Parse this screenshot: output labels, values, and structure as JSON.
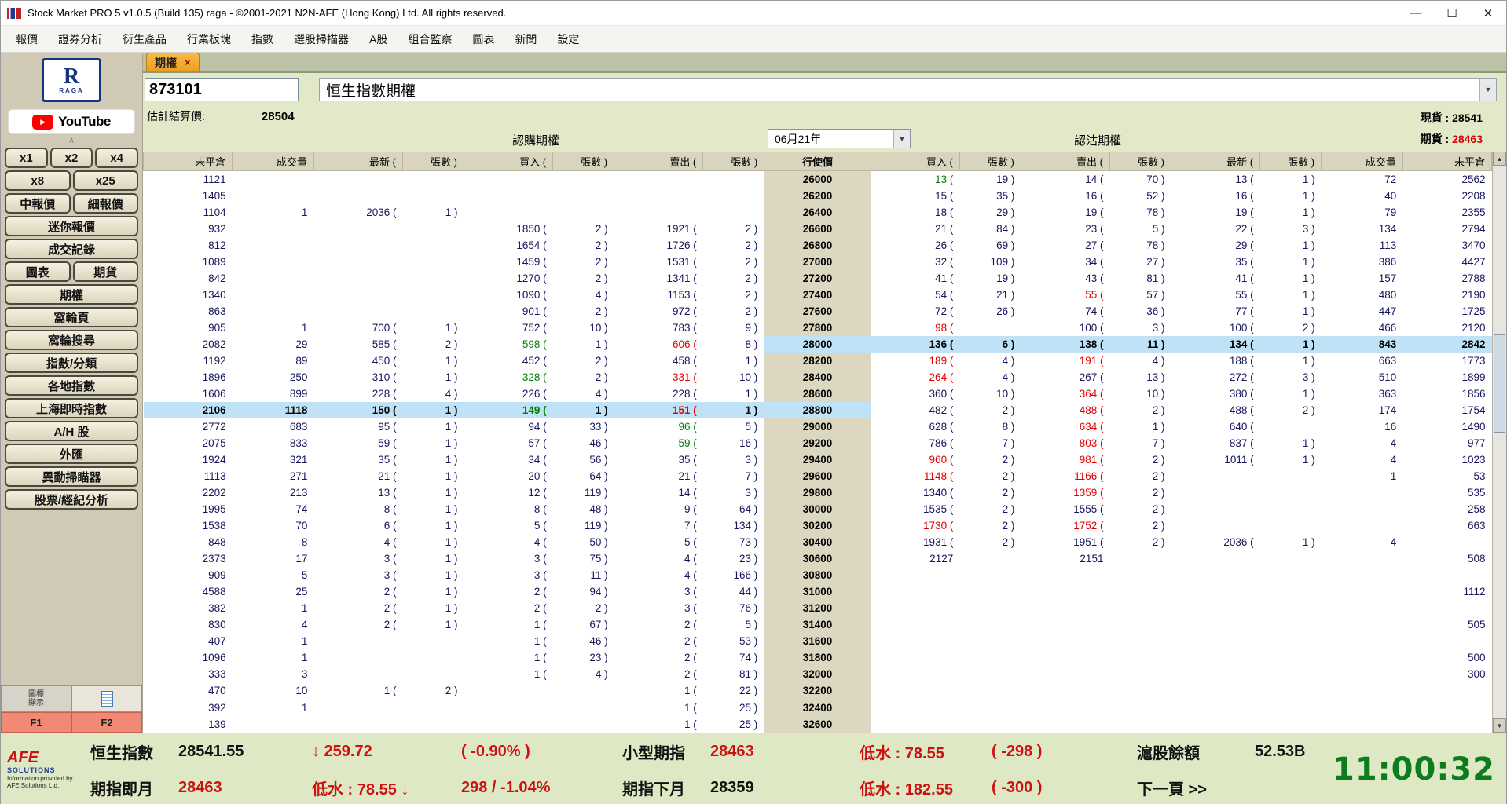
{
  "colors": {
    "accent_orange": "#ee9e1f",
    "up_green": "#007f00",
    "down_red": "#e00000",
    "highlight_blue": "#bfe2f6",
    "status_red": "#cc1111",
    "strike_beige": "#dcd7c1"
  },
  "window": {
    "title": "Stock Market PRO 5 v1.0.5 (Build 135) raga - ©2001-2021 N2N-AFE (Hong Kong) Ltd. All rights reserved.",
    "controls": {
      "minimize": "—",
      "maximize": "☐",
      "close": "✕"
    }
  },
  "menu": {
    "items": [
      "報價",
      "證券分析",
      "衍生產品",
      "行業板塊",
      "指數",
      "選股掃描器",
      "A股",
      "組合監察",
      "圖表",
      "新聞",
      "設定"
    ]
  },
  "sidebar": {
    "logo_r": "R",
    "logo_sub": "RAGA",
    "youtube": "YouTube",
    "play_icon": "▶",
    "collapse": "∧",
    "rows": [
      [
        "x1",
        "x2",
        "x4"
      ],
      [
        "x8",
        "x25"
      ],
      [
        "中報價",
        "細報價"
      ],
      [
        "迷你報價"
      ],
      [
        "成交記錄"
      ],
      [
        "圖表",
        "期貨"
      ],
      [
        "期權"
      ],
      [
        "窩輪頁"
      ],
      [
        "窩輪搜尋"
      ],
      [
        "指數/分類"
      ],
      [
        "各地指數"
      ],
      [
        "上海即時指數"
      ],
      [
        "A/H 股"
      ],
      [
        "外匯"
      ],
      [
        "異動掃瞄器"
      ],
      [
        "股票/經紀分析"
      ]
    ],
    "icon_display": "圖標顯示",
    "f1": "F1",
    "f2": "F2"
  },
  "quote": {
    "tab": "期權",
    "tab_close": "×",
    "symbol_input": "873101",
    "name": "恒生指數期權",
    "dropdown_icon": "▼",
    "est_settle_label": "估計結算價:",
    "est_settle": "28504",
    "spot_label": "現貨 :",
    "spot": "28541",
    "futures_label": "期貨 :",
    "futures": "28463",
    "call_header": "認購期權",
    "put_header": "認沽期權",
    "month": "06月21年"
  },
  "options_table": {
    "headers": [
      "未平倉",
      "成交量",
      "最新 (",
      "張數 )",
      "買入 (",
      "張數 )",
      "賣出 (",
      "張數 )",
      "行使價",
      "買入 (",
      "張數 )",
      "賣出 (",
      "張數 )",
      "最新 (",
      "張數 )",
      "成交量",
      "未平倉"
    ],
    "rows": [
      {
        "c": [
          "1121",
          "",
          "",
          "",
          "",
          "",
          "",
          "",
          "26000",
          "13 (",
          "19 )",
          "14 (",
          "70 )",
          "13 (",
          "1 )",
          "72",
          "2562"
        ],
        "k": {
          "9": "g"
        }
      },
      {
        "c": [
          "1405",
          "",
          "",
          "",
          "",
          "",
          "",
          "",
          "26200",
          "15 (",
          "35 )",
          "16 (",
          "52 )",
          "16 (",
          "1 )",
          "40",
          "2208"
        ]
      },
      {
        "c": [
          "1104",
          "1",
          "2036 (",
          "1 )",
          "",
          "",
          "",
          "",
          "26400",
          "18 (",
          "29 )",
          "19 (",
          "78 )",
          "19 (",
          "1 )",
          "79",
          "2355"
        ]
      },
      {
        "c": [
          "932",
          "",
          "",
          "",
          "1850 (",
          "2 )",
          "1921 (",
          "2 )",
          "26600",
          "21 (",
          "84 )",
          "23 (",
          "5 )",
          "22 (",
          "3 )",
          "134",
          "2794"
        ]
      },
      {
        "c": [
          "812",
          "",
          "",
          "",
          "1654 (",
          "2 )",
          "1726 (",
          "2 )",
          "26800",
          "26 (",
          "69 )",
          "27 (",
          "78 )",
          "29 (",
          "1 )",
          "113",
          "3470"
        ]
      },
      {
        "c": [
          "1089",
          "",
          "",
          "",
          "1459 (",
          "2 )",
          "1531 (",
          "2 )",
          "27000",
          "32 (",
          "109 )",
          "34 (",
          "27 )",
          "35 (",
          "1 )",
          "386",
          "4427"
        ]
      },
      {
        "c": [
          "842",
          "",
          "",
          "",
          "1270 (",
          "2 )",
          "1341 (",
          "2 )",
          "27200",
          "41 (",
          "19 )",
          "43 (",
          "81 )",
          "41 (",
          "1 )",
          "157",
          "2788"
        ]
      },
      {
        "c": [
          "1340",
          "",
          "",
          "",
          "1090 (",
          "4 )",
          "1153 (",
          "2 )",
          "27400",
          "54 (",
          "21 )",
          "55 (",
          "57 )",
          "55 (",
          "1 )",
          "480",
          "2190"
        ],
        "k": {
          "11": "r"
        }
      },
      {
        "c": [
          "863",
          "",
          "",
          "",
          "901 (",
          "2 )",
          "972 (",
          "2 )",
          "27600",
          "72 (",
          "26 )",
          "74 (",
          "36 )",
          "77 (",
          "1 )",
          "447",
          "1725"
        ]
      },
      {
        "c": [
          "905",
          "1",
          "700 (",
          "1 )",
          "752 (",
          "10 )",
          "783 (",
          "9 )",
          "27800",
          "98 (",
          "",
          "100 (",
          "3 )",
          "100 (",
          "2 )",
          "466",
          "2120"
        ],
        "k": {
          "9": "r"
        }
      },
      {
        "c": [
          "2082",
          "29",
          "585 (",
          "2 )",
          "598 (",
          "1 )",
          "606 (",
          "8 )",
          "28000",
          "136 (",
          "6 )",
          "138 (",
          "11 )",
          "134 (",
          "1 )",
          "843",
          "2842"
        ],
        "k": {
          "4": "g",
          "6": "r"
        },
        "h": "put"
      },
      {
        "c": [
          "1192",
          "89",
          "450 (",
          "1 )",
          "452 (",
          "2 )",
          "458 (",
          "1 )",
          "28200",
          "189 (",
          "4 )",
          "191 (",
          "4 )",
          "188 (",
          "1 )",
          "663",
          "1773"
        ],
        "k": {
          "9": "r",
          "11": "r"
        }
      },
      {
        "c": [
          "1896",
          "250",
          "310 (",
          "1 )",
          "328 (",
          "2 )",
          "331 (",
          "10 )",
          "28400",
          "264 (",
          "4 )",
          "267 (",
          "13 )",
          "272 (",
          "3 )",
          "510",
          "1899"
        ],
        "k": {
          "4": "g",
          "6": "r",
          "9": "r"
        }
      },
      {
        "c": [
          "1606",
          "899",
          "228 (",
          "4 )",
          "226 (",
          "4 )",
          "228 (",
          "1 )",
          "28600",
          "360 (",
          "10 )",
          "364 (",
          "10 )",
          "380 (",
          "1 )",
          "363",
          "1856"
        ],
        "k": {
          "11": "r"
        }
      },
      {
        "c": [
          "2106",
          "1118",
          "150 (",
          "1 )",
          "149 (",
          "1 )",
          "151 (",
          "1 )",
          "28800",
          "482 (",
          "2 )",
          "488 (",
          "2 )",
          "488 (",
          "2 )",
          "174",
          "1754"
        ],
        "k": {
          "4": "g",
          "6": "r",
          "11": "r"
        },
        "h": "call"
      },
      {
        "c": [
          "2772",
          "683",
          "95 (",
          "1 )",
          "94 (",
          "33 )",
          "96 (",
          "5 )",
          "29000",
          "628 (",
          "8 )",
          "634 (",
          "1 )",
          "640 (",
          "",
          "16",
          "1490"
        ],
        "k": {
          "6": "g",
          "11": "r"
        }
      },
      {
        "c": [
          "2075",
          "833",
          "59 (",
          "1 )",
          "57 (",
          "46 )",
          "59 (",
          "16 )",
          "29200",
          "786 (",
          "7 )",
          "803 (",
          "7 )",
          "837 (",
          "1 )",
          "4",
          "977"
        ],
        "k": {
          "6": "g",
          "11": "r"
        }
      },
      {
        "c": [
          "1924",
          "321",
          "35 (",
          "1 )",
          "34 (",
          "56 )",
          "35 (",
          "3 )",
          "29400",
          "960 (",
          "2 )",
          "981 (",
          "2 )",
          "1011 (",
          "1 )",
          "4",
          "1023"
        ],
        "k": {
          "9": "r",
          "11": "r"
        }
      },
      {
        "c": [
          "1113",
          "271",
          "21 (",
          "1 )",
          "20 (",
          "64 )",
          "21 (",
          "7 )",
          "29600",
          "1148 (",
          "2 )",
          "1166 (",
          "2 )",
          "",
          "",
          "1",
          "53"
        ],
        "k": {
          "9": "r",
          "11": "r"
        }
      },
      {
        "c": [
          "2202",
          "213",
          "13 (",
          "1 )",
          "12 (",
          "119 )",
          "14 (",
          "3 )",
          "29800",
          "1340 (",
          "2 )",
          "1359 (",
          "2 )",
          "",
          "",
          "",
          "535"
        ],
        "k": {
          "11": "r"
        }
      },
      {
        "c": [
          "1995",
          "74",
          "8 (",
          "1 )",
          "8 (",
          "48 )",
          "9 (",
          "64 )",
          "30000",
          "1535 (",
          "2 )",
          "1555 (",
          "2 )",
          "",
          "",
          "",
          "258"
        ]
      },
      {
        "c": [
          "1538",
          "70",
          "6 (",
          "1 )",
          "5 (",
          "119 )",
          "7 (",
          "134 )",
          "30200",
          "1730 (",
          "2 )",
          "1752 (",
          "2 )",
          "",
          "",
          "",
          "663"
        ],
        "k": {
          "9": "r",
          "11": "r"
        }
      },
      {
        "c": [
          "848",
          "8",
          "4 (",
          "1 )",
          "4 (",
          "50 )",
          "5 (",
          "73 )",
          "30400",
          "1931 (",
          "2 )",
          "1951 (",
          "2 )",
          "2036 (",
          "1 )",
          "4",
          ""
        ]
      },
      {
        "c": [
          "2373",
          "17",
          "3 (",
          "1 )",
          "3 (",
          "75 )",
          "4 (",
          "23 )",
          "30600",
          "2127",
          "",
          "2151",
          "",
          "",
          "",
          "",
          "508"
        ]
      },
      {
        "c": [
          "909",
          "5",
          "3 (",
          "1 )",
          "3 (",
          "11 )",
          "4 (",
          "166 )",
          "30800",
          "",
          "",
          "",
          "",
          "",
          "",
          "",
          ""
        ]
      },
      {
        "c": [
          "4588",
          "25",
          "2 (",
          "1 )",
          "2 (",
          "94 )",
          "3 (",
          "44 )",
          "31000",
          "",
          "",
          "",
          "",
          "",
          "",
          "",
          "1112"
        ]
      },
      {
        "c": [
          "382",
          "1",
          "2 (",
          "1 )",
          "2 (",
          "2 )",
          "3 (",
          "76 )",
          "31200",
          "",
          "",
          "",
          "",
          "",
          "",
          "",
          ""
        ]
      },
      {
        "c": [
          "830",
          "4",
          "2 (",
          "1 )",
          "1 (",
          "67 )",
          "2 (",
          "5 )",
          "31400",
          "",
          "",
          "",
          "",
          "",
          "",
          "",
          "505"
        ]
      },
      {
        "c": [
          "407",
          "1",
          "",
          "",
          "1 (",
          "46 )",
          "2 (",
          "53 )",
          "31600",
          "",
          "",
          "",
          "",
          "",
          "",
          "",
          ""
        ]
      },
      {
        "c": [
          "1096",
          "1",
          "",
          "",
          "1 (",
          "23 )",
          "2 (",
          "74 )",
          "31800",
          "",
          "",
          "",
          "",
          "",
          "",
          "",
          "500"
        ]
      },
      {
        "c": [
          "333",
          "3",
          "",
          "",
          "1 (",
          "4 )",
          "2 (",
          "81 )",
          "32000",
          "",
          "",
          "",
          "",
          "",
          "",
          "",
          "300"
        ]
      },
      {
        "c": [
          "470",
          "10",
          "1 (",
          "2 )",
          "",
          "",
          "1 (",
          "22 )",
          "32200",
          "",
          "",
          "",
          "",
          "",
          "",
          "",
          ""
        ]
      },
      {
        "c": [
          "392",
          "1",
          "",
          "",
          "",
          "",
          "1 (",
          "25 )",
          "32400",
          "",
          "",
          "",
          "",
          "",
          "",
          "",
          ""
        ]
      },
      {
        "c": [
          "139",
          "",
          "",
          "",
          "",
          "",
          "1 (",
          "25 )",
          "32600",
          "",
          "",
          "",
          "",
          "",
          "",
          "",
          ""
        ]
      }
    ]
  },
  "scrollbar": {
    "up_icon": "▲",
    "down_icon": "▼"
  },
  "status": {
    "rows": [
      [
        {
          "t": "恒生指數",
          "c": "k"
        },
        {
          "t": "28541.55",
          "c": "k"
        },
        {
          "t": "↓ 259.72",
          "c": "r"
        },
        {
          "t": "(   -0.90%   )",
          "c": "r"
        },
        {
          "t": "小型期指",
          "c": "k"
        },
        {
          "t": "28463",
          "c": "r"
        },
        {
          "t": "低水 : 78.55",
          "c": "r"
        },
        {
          "t": "(   -298   )",
          "c": "r"
        },
        {
          "t": "滬股餘額",
          "c": "k"
        },
        {
          "t": "52.53B",
          "c": "k"
        }
      ],
      [
        {
          "t": "期指即月",
          "c": "k"
        },
        {
          "t": "28463",
          "c": "r"
        },
        {
          "t": "低水 : 78.55 ↓",
          "c": "r"
        },
        {
          "t": "298 /  -1.04%",
          "c": "r"
        },
        {
          "t": "期指下月",
          "c": "k"
        },
        {
          "t": "28359",
          "c": "k"
        },
        {
          "t": "低水 : 182.55",
          "c": "r"
        },
        {
          "t": "(   -300   )",
          "c": "r"
        },
        {
          "t": "下一頁 >>",
          "c": "k"
        },
        {
          "t": "",
          "c": "k"
        }
      ]
    ],
    "clock": "11:00:32",
    "afe": {
      "brand": "AFE",
      "sub": "SOLUTIONS",
      "note": "Information provided by AFE Solutions Ltd."
    }
  }
}
